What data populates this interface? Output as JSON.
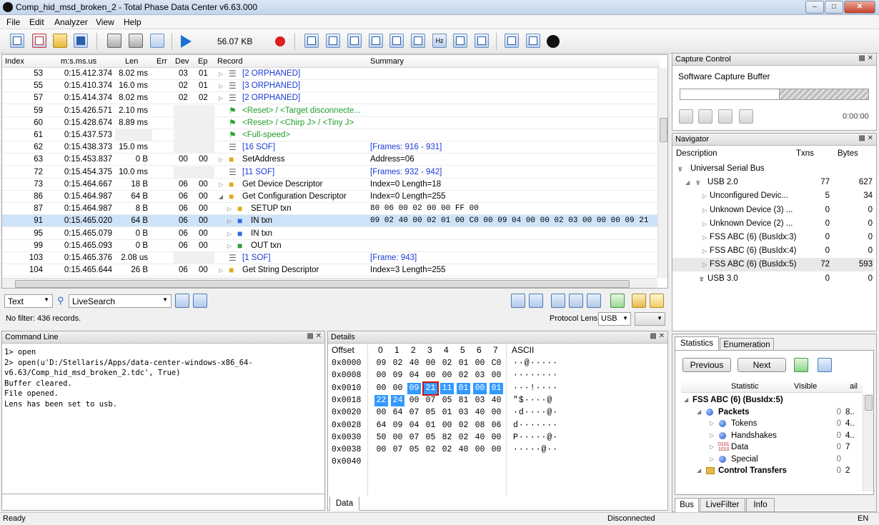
{
  "window": {
    "title": "Comp_hid_msd_broken_2 - Total Phase Data Center v6.63.000"
  },
  "menu": [
    "File",
    "Edit",
    "Analyzer",
    "View",
    "Help"
  ],
  "toolbar": {
    "capture_size": "56.07 KB"
  },
  "table": {
    "headers": [
      "Index",
      "m:s.ms.us",
      "Len",
      "Err",
      "Dev",
      "Ep",
      "Record",
      "Summary"
    ],
    "rows": [
      {
        "index": "53",
        "time": "0:15.412.374",
        "len": "8.02 ms",
        "err": "",
        "dev": "03",
        "ep": "01",
        "record": "[2 ORPHANED]",
        "summary": "",
        "kind": "orphan"
      },
      {
        "index": "55",
        "time": "0:15.410.374",
        "len": "16.0 ms",
        "err": "",
        "dev": "02",
        "ep": "01",
        "record": "[3 ORPHANED]",
        "summary": "",
        "kind": "orphan"
      },
      {
        "index": "57",
        "time": "0:15.414.374",
        "len": "8.02 ms",
        "err": "",
        "dev": "02",
        "ep": "02",
        "record": "[2 ORPHANED]",
        "summary": "",
        "kind": "orphan"
      },
      {
        "index": "59",
        "time": "0:15.426.571",
        "len": "2.10 ms",
        "err": "",
        "dev": "",
        "ep": "",
        "record": "<Reset> / <Target disconnecte...",
        "summary": "",
        "kind": "event"
      },
      {
        "index": "60",
        "time": "0:15.428.674",
        "len": "8.89 ms",
        "err": "",
        "dev": "",
        "ep": "",
        "record": "<Reset> / <Chirp J> / <Tiny J>",
        "summary": "",
        "kind": "event"
      },
      {
        "index": "61",
        "time": "0:15.437.573",
        "len": "",
        "err": "",
        "dev": "",
        "ep": "",
        "record": "<Full-speed>",
        "summary": "",
        "kind": "event"
      },
      {
        "index": "62",
        "time": "0:15.438.373",
        "len": "15.0 ms",
        "err": "",
        "dev": "",
        "ep": "",
        "record": "[16 SOF]",
        "summary": "[Frames: 916 - 931]",
        "kind": "sof"
      },
      {
        "index": "63",
        "time": "0:15.453.837",
        "len": "0 B",
        "err": "",
        "dev": "00",
        "ep": "00",
        "record": "SetAddress",
        "summary": "Address=06",
        "kind": "ctrl"
      },
      {
        "index": "72",
        "time": "0:15.454.375",
        "len": "10.0 ms",
        "err": "",
        "dev": "",
        "ep": "",
        "record": "[11 SOF]",
        "summary": "[Frames: 932 - 942]",
        "kind": "sof"
      },
      {
        "index": "73",
        "time": "0:15.464.667",
        "len": "18 B",
        "err": "",
        "dev": "06",
        "ep": "00",
        "record": "Get Device Descriptor",
        "summary": "Index=0 Length=18",
        "kind": "ctrl"
      },
      {
        "index": "86",
        "time": "0:15.464.987",
        "len": "64 B",
        "err": "",
        "dev": "06",
        "ep": "00",
        "record": "Get Configuration Descriptor",
        "summary": "Index=0 Length=255",
        "kind": "ctrl-open"
      },
      {
        "index": "87",
        "time": "0:15.464.987",
        "len": "8 B",
        "err": "",
        "dev": "06",
        "ep": "00",
        "record": "SETUP txn",
        "summary": "80 06 00 02 00 00 FF 00",
        "kind": "setup"
      },
      {
        "index": "91",
        "time": "0:15.465.020",
        "len": "64 B",
        "err": "",
        "dev": "06",
        "ep": "00",
        "record": "IN txn",
        "summary": "09 02 40 00 02 01 00 C0 00 09 04 00 00 02 03 00 00 00 09 21",
        "kind": "in",
        "selected": true
      },
      {
        "index": "95",
        "time": "0:15.465.079",
        "len": "0 B",
        "err": "",
        "dev": "06",
        "ep": "00",
        "record": "IN txn",
        "summary": "",
        "kind": "in"
      },
      {
        "index": "99",
        "time": "0:15.465.093",
        "len": "0 B",
        "err": "",
        "dev": "06",
        "ep": "00",
        "record": "OUT txn",
        "summary": "",
        "kind": "out"
      },
      {
        "index": "103",
        "time": "0:15.465.376",
        "len": "2.08 us",
        "err": "",
        "dev": "",
        "ep": "",
        "record": "[1 SOF]",
        "summary": "[Frame: 943]",
        "kind": "sof"
      },
      {
        "index": "104",
        "time": "0:15.465.644",
        "len": "26 B",
        "err": "",
        "dev": "06",
        "ep": "00",
        "record": "Get String Descriptor",
        "summary": "Index=3 Length=255",
        "kind": "ctrl"
      }
    ]
  },
  "filter_bar": {
    "mode": "Text",
    "search": "LiveSearch",
    "status": "No filter: 436 records.",
    "lens_label": "Protocol Lens:",
    "lens_value": "USB"
  },
  "command_line": {
    "title": "Command Line",
    "lines": [
      "1> open",
      "2> open(u'D:/Stellaris/Apps/data-center-windows-x86_64-",
      "v6.63/Comp_hid_msd_broken_2.tdc', True)",
      "Buffer cleared.",
      "File opened.",
      "Lens has been set to usb."
    ]
  },
  "details": {
    "title": "Details",
    "headers": [
      "Offset",
      "0",
      "1",
      "2",
      "3",
      "4",
      "5",
      "6",
      "7",
      "ASCII"
    ],
    "rows": [
      {
        "offset": "0x0000",
        "bytes": [
          "09",
          "02",
          "40",
          "00",
          "02",
          "01",
          "00",
          "C0"
        ],
        "ascii": "··@·····"
      },
      {
        "offset": "0x0008",
        "bytes": [
          "00",
          "09",
          "04",
          "00",
          "00",
          "02",
          "03",
          "00"
        ],
        "ascii": "········"
      },
      {
        "offset": "0x0010",
        "bytes": [
          "00",
          "00",
          "09",
          "21",
          "11",
          "01",
          "00",
          "01"
        ],
        "ascii": "···!····"
      },
      {
        "offset": "0x0018",
        "bytes": [
          "22",
          "24",
          "00",
          "07",
          "05",
          "81",
          "03",
          "40"
        ],
        "ascii": "\"$····@"
      },
      {
        "offset": "0x0020",
        "bytes": [
          "00",
          "64",
          "07",
          "05",
          "01",
          "03",
          "40",
          "00"
        ],
        "ascii": "·d····@·"
      },
      {
        "offset": "0x0028",
        "bytes": [
          "64",
          "09",
          "04",
          "01",
          "00",
          "02",
          "08",
          "06"
        ],
        "ascii": "d·······"
      },
      {
        "offset": "0x0030",
        "bytes": [
          "50",
          "00",
          "07",
          "05",
          "82",
          "02",
          "40",
          "00"
        ],
        "ascii": "P·····@·"
      },
      {
        "offset": "0x0038",
        "bytes": [
          "00",
          "07",
          "05",
          "02",
          "02",
          "40",
          "00",
          "00"
        ],
        "ascii": "·····@··"
      },
      {
        "offset": "0x0040",
        "bytes": [],
        "ascii": ""
      }
    ],
    "tab": "Data"
  },
  "capture_control": {
    "title": "Capture Control",
    "label": "Software Capture Buffer",
    "fill_fraction": 0.53,
    "time": "0:00:00"
  },
  "navigator": {
    "title": "Navigator",
    "headers": [
      "Description",
      "Txns",
      "Bytes"
    ],
    "rows": [
      {
        "label": "Universal Serial Bus",
        "txns": "",
        "bytes": "",
        "level": 0
      },
      {
        "label": "USB 2.0",
        "txns": "77",
        "bytes": "627",
        "level": 1
      },
      {
        "label": "Unconfigured Devic...",
        "txns": "5",
        "bytes": "34",
        "level": 2
      },
      {
        "label": "Unknown Device (3) ...",
        "txns": "0",
        "bytes": "0",
        "level": 2
      },
      {
        "label": "Unknown Device (2) ...",
        "txns": "0",
        "bytes": "0",
        "level": 2
      },
      {
        "label": "FSS ABC (6) (BusIdx:3)",
        "txns": "0",
        "bytes": "0",
        "level": 2
      },
      {
        "label": "FSS ABC (6) (BusIdx:4)",
        "txns": "0",
        "bytes": "0",
        "level": 2
      },
      {
        "label": "FSS ABC (6) (BusIdx:5)",
        "txns": "72",
        "bytes": "593",
        "level": 2,
        "selected": true
      },
      {
        "label": "USB 3.0",
        "txns": "0",
        "bytes": "0",
        "level": 1
      }
    ]
  },
  "statistics": {
    "tabs": [
      "Statistics",
      "Enumeration"
    ],
    "prev": "Previous",
    "next": "Next",
    "headers": [
      "Statistic",
      "Visible",
      "ail"
    ],
    "rows": [
      {
        "label": "FSS ABC (6) (BusIdx:5)",
        "v": "",
        "a": "",
        "level": 0,
        "bold": true
      },
      {
        "label": "Packets",
        "v": "0",
        "a": "8..",
        "level": 1,
        "bold": true
      },
      {
        "label": "Tokens",
        "v": "0",
        "a": "4..",
        "level": 2
      },
      {
        "label": "Handshakes",
        "v": "0",
        "a": "4..",
        "level": 2
      },
      {
        "label": "Data",
        "v": "0",
        "a": "7",
        "level": 2
      },
      {
        "label": "Special",
        "v": "0",
        "a": "",
        "level": 2
      },
      {
        "label": "Control Transfers",
        "v": "0",
        "a": "2",
        "level": 1,
        "bold": true
      }
    ],
    "bottom_tabs": [
      "Bus",
      "LiveFilter",
      "Info"
    ]
  },
  "status": {
    "left": "Ready",
    "middle": "Disconnected",
    "right": "EN"
  }
}
